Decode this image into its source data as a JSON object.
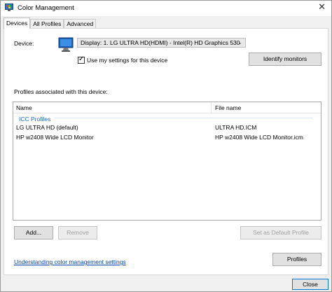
{
  "window": {
    "title": "Color Management",
    "close_glyph": "✕"
  },
  "tabs": [
    {
      "label": "Devices",
      "active": true
    },
    {
      "label": "All Profiles",
      "active": false
    },
    {
      "label": "Advanced",
      "active": false
    }
  ],
  "devices": {
    "device_label": "Device:",
    "selected_device": "Display: 1. LG ULTRA HD(HDMI) - Intel(R) HD Graphics 530",
    "use_my_settings": {
      "label": "Use my settings for this device",
      "checked": true
    },
    "identify_button": "Identify monitors",
    "profiles_heading": "Profiles associated with this device:",
    "columns": {
      "name": "Name",
      "file": "File name"
    },
    "group_label": "ICC Profiles",
    "profiles": [
      {
        "name": "LG ULTRA HD (default)",
        "file": "ULTRA HD.ICM"
      },
      {
        "name": "HP w2408 Wide LCD Monitor",
        "file": "HP w2408 Wide LCD Monitor.icm"
      }
    ],
    "buttons": {
      "add": "Add...",
      "remove": "Remove",
      "set_default": "Set as Default Profile",
      "profiles": "Profiles"
    },
    "help_link": "Understanding color management settings"
  },
  "footer": {
    "close_button": "Close"
  },
  "colors": {
    "accent": "#0078d7",
    "link": "#0645ad",
    "group": "#1e63c4"
  },
  "icons": [
    "color-management-icon",
    "monitor-icon",
    "chevron-down-icon",
    "checkmark-icon",
    "close-icon"
  ]
}
